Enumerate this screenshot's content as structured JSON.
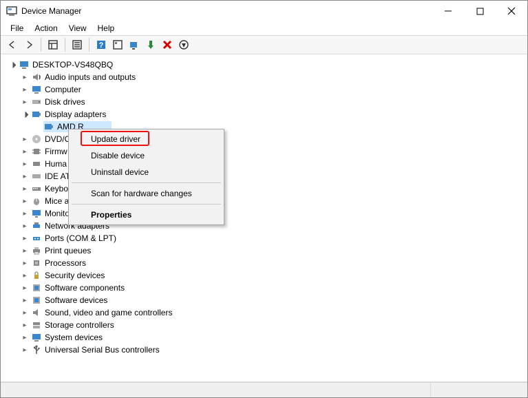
{
  "window": {
    "title": "Device Manager"
  },
  "menu": {
    "file": "File",
    "action": "Action",
    "view": "View",
    "help": "Help"
  },
  "tree": {
    "root": "DESKTOP-VS48QBQ",
    "audio": "Audio inputs and outputs",
    "computer": "Computer",
    "disk": "Disk drives",
    "display_adapters": "Display adapters",
    "amd_device": "AMD R",
    "dvd": "DVD/C",
    "firmware": "Firmw",
    "human": "Huma",
    "ide": "IDE AT",
    "keyboard": "Keybo",
    "mice": "Mice a",
    "monitors": "Monitors",
    "network": "Network adapters",
    "ports": "Ports (COM & LPT)",
    "print_queues": "Print queues",
    "processors": "Processors",
    "security": "Security devices",
    "sw_components": "Software components",
    "sw_devices": "Software devices",
    "sound": "Sound, video and game controllers",
    "storage": "Storage controllers",
    "system": "System devices",
    "usb": "Universal Serial Bus controllers"
  },
  "context_menu": {
    "update_driver": "Update driver",
    "disable_device": "Disable device",
    "uninstall_device": "Uninstall device",
    "scan": "Scan for hardware changes",
    "properties": "Properties"
  }
}
